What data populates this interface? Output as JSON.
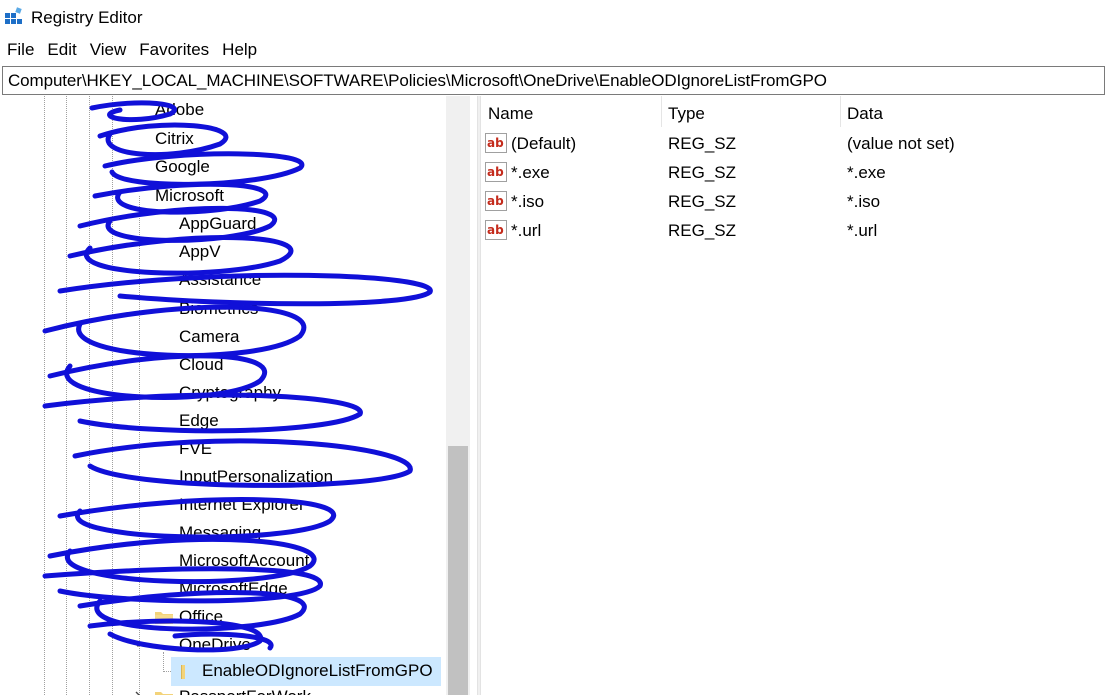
{
  "window": {
    "title": "Registry Editor",
    "icon": "registry-editor-icon"
  },
  "menu": [
    "File",
    "Edit",
    "View",
    "Favorites",
    "Help"
  ],
  "address": "Computer\\HKEY_LOCAL_MACHINE\\SOFTWARE\\Policies\\Microsoft\\OneDrive\\EnableODIgnoreListFromGPO",
  "tree": {
    "items": [
      {
        "label": "Adobe"
      },
      {
        "label": "Citrix"
      },
      {
        "label": "Google"
      },
      {
        "label": "Microsoft"
      },
      {
        "label": "AppGuard"
      },
      {
        "label": "AppV"
      },
      {
        "label": "Assistance"
      },
      {
        "label": "Biometrics"
      },
      {
        "label": "Camera"
      },
      {
        "label": "Cloud"
      },
      {
        "label": "Cryptography"
      },
      {
        "label": "Edge"
      },
      {
        "label": "FVE"
      },
      {
        "label": "InputPersonalization"
      },
      {
        "label": "Internet Explorer"
      },
      {
        "label": "Messaging"
      },
      {
        "label": "MicrosoftAccount"
      },
      {
        "label": "MicrosoftEdge"
      },
      {
        "label": "Office"
      },
      {
        "label": "OneDrive"
      },
      {
        "label": "EnableODIgnoreListFromGPO"
      },
      {
        "label": "PassportForWork"
      }
    ]
  },
  "list": {
    "columns": {
      "name": "Name",
      "type": "Type",
      "data": "Data"
    },
    "rows": [
      {
        "name": "(Default)",
        "type": "REG_SZ",
        "data": "(value not set)"
      },
      {
        "name": "*.exe",
        "type": "REG_SZ",
        "data": "*.exe"
      },
      {
        "name": "*.iso",
        "type": "REG_SZ",
        "data": "*.iso"
      },
      {
        "name": "*.url",
        "type": "REG_SZ",
        "data": "*.url"
      }
    ]
  },
  "colors": {
    "selection": "#cce8ff",
    "folder": "#f3d37a",
    "scribble": "#1010d8",
    "string_value_icon": "#c42b1c"
  }
}
